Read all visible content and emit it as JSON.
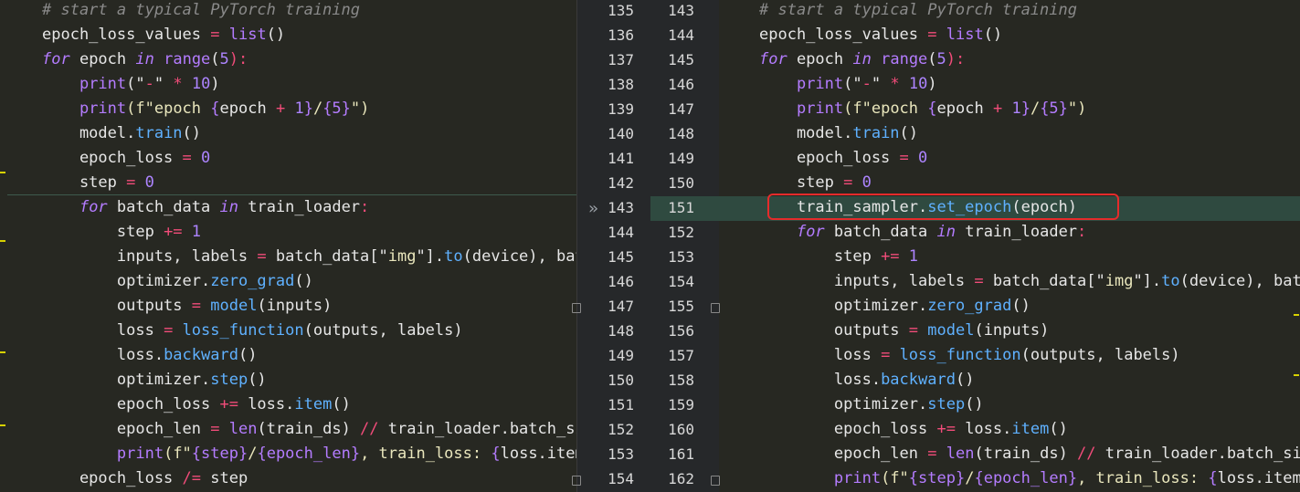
{
  "left_pane": {
    "lines": [
      [
        [
          "# start a typical PyTorch training",
          "comment"
        ]
      ],
      [
        [
          "epoch_loss_values ",
          "plain"
        ],
        [
          "=",
          "op"
        ],
        [
          " ",
          "plain"
        ],
        [
          "list",
          "builtin"
        ],
        [
          "()",
          "plain"
        ]
      ],
      [
        [
          "for",
          "keyword"
        ],
        [
          " epoch ",
          "plain"
        ],
        [
          "in",
          "keyword"
        ],
        [
          " ",
          "plain"
        ],
        [
          "range",
          "builtin"
        ],
        [
          "(",
          "plain"
        ],
        [
          "5",
          "num"
        ],
        [
          "):",
          "op"
        ]
      ],
      [
        [
          "    ",
          "plain"
        ],
        [
          "print",
          "builtin"
        ],
        [
          "(\"",
          "plain"
        ],
        [
          "-",
          "op"
        ],
        [
          "\"",
          "plain"
        ],
        [
          " * ",
          "op"
        ],
        [
          "10",
          "num"
        ],
        [
          ")",
          "plain"
        ]
      ],
      [
        [
          "    ",
          "plain"
        ],
        [
          "print",
          "builtin"
        ],
        [
          "(f\"epoch ",
          "str"
        ],
        [
          "{",
          "fmt"
        ],
        [
          "epoch ",
          "plain"
        ],
        [
          "+",
          "op"
        ],
        [
          " ",
          "plain"
        ],
        [
          "1",
          "num"
        ],
        [
          "}",
          "fmt"
        ],
        [
          "/",
          "str"
        ],
        [
          "{5}",
          "fmt"
        ],
        [
          "\")",
          "str"
        ]
      ],
      [
        [
          "    model.",
          "plain"
        ],
        [
          "train",
          "func"
        ],
        [
          "()",
          "plain"
        ]
      ],
      [
        [
          "    epoch_loss ",
          "plain"
        ],
        [
          "=",
          "op"
        ],
        [
          " ",
          "plain"
        ],
        [
          "0",
          "num"
        ]
      ],
      [
        [
          "    step ",
          "plain"
        ],
        [
          "=",
          "op"
        ],
        [
          " ",
          "plain"
        ],
        [
          "0",
          "num"
        ]
      ],
      [
        [
          "    ",
          "plain"
        ],
        [
          "for",
          "keyword"
        ],
        [
          " batch_data ",
          "plain"
        ],
        [
          "in",
          "keyword"
        ],
        [
          " train_loader",
          "plain"
        ],
        [
          ":",
          "op"
        ]
      ],
      [
        [
          "        step ",
          "plain"
        ],
        [
          "+=",
          "op"
        ],
        [
          " ",
          "plain"
        ],
        [
          "1",
          "num"
        ]
      ],
      [
        [
          "        inputs, labels ",
          "plain"
        ],
        [
          "=",
          "op"
        ],
        [
          " batch_data[\"",
          "plain"
        ],
        [
          "img",
          "str"
        ],
        [
          "\"].",
          "plain"
        ],
        [
          "to",
          "func"
        ],
        [
          "(device), bat",
          "plain"
        ]
      ],
      [
        [
          "        optimizer.",
          "plain"
        ],
        [
          "zero_grad",
          "func"
        ],
        [
          "()",
          "plain"
        ]
      ],
      [
        [
          "        outputs ",
          "plain"
        ],
        [
          "=",
          "op"
        ],
        [
          " ",
          "plain"
        ],
        [
          "model",
          "func"
        ],
        [
          "(inputs)",
          "plain"
        ]
      ],
      [
        [
          "        loss ",
          "plain"
        ],
        [
          "=",
          "op"
        ],
        [
          " ",
          "plain"
        ],
        [
          "loss_function",
          "func"
        ],
        [
          "(outputs, labels)",
          "plain"
        ]
      ],
      [
        [
          "        loss.",
          "plain"
        ],
        [
          "backward",
          "func"
        ],
        [
          "()",
          "plain"
        ]
      ],
      [
        [
          "        optimizer.",
          "plain"
        ],
        [
          "step",
          "func"
        ],
        [
          "()",
          "plain"
        ]
      ],
      [
        [
          "        epoch_loss ",
          "plain"
        ],
        [
          "+=",
          "op"
        ],
        [
          " loss.",
          "plain"
        ],
        [
          "item",
          "func"
        ],
        [
          "()",
          "plain"
        ]
      ],
      [
        [
          "        epoch_len ",
          "plain"
        ],
        [
          "=",
          "op"
        ],
        [
          " ",
          "plain"
        ],
        [
          "len",
          "builtin"
        ],
        [
          "(train_ds) ",
          "plain"
        ],
        [
          "//",
          "op"
        ],
        [
          " train_loader.batch_si",
          "plain"
        ]
      ],
      [
        [
          "        ",
          "plain"
        ],
        [
          "print",
          "builtin"
        ],
        [
          "(f\"",
          "str"
        ],
        [
          "{step}",
          "fmt"
        ],
        [
          "/",
          "str"
        ],
        [
          "{epoch_len}",
          "fmt"
        ],
        [
          ", train_loss: ",
          "str"
        ],
        [
          "{",
          "fmt"
        ],
        [
          "loss.item",
          "plain"
        ]
      ],
      [
        [
          "    epoch_loss ",
          "plain"
        ],
        [
          "/=",
          "op"
        ],
        [
          " step",
          "plain"
        ]
      ]
    ]
  },
  "gutter": {
    "left_numbers": [
      "135",
      "136",
      "137",
      "138",
      "139",
      "140",
      "141",
      "142",
      "143",
      "144",
      "145",
      "146",
      "147",
      "148",
      "149",
      "150",
      "151",
      "152",
      "153",
      "154"
    ],
    "right_numbers": [
      "143",
      "144",
      "145",
      "146",
      "147",
      "148",
      "149",
      "150",
      "151",
      "152",
      "153",
      "154",
      "155",
      "156",
      "157",
      "158",
      "159",
      "160",
      "161",
      "162"
    ],
    "left_arrow_icon": "»",
    "right_arrow_icon": "«"
  },
  "right_pane": {
    "lines": [
      [
        [
          "# start a typical PyTorch training",
          "comment"
        ]
      ],
      [
        [
          "epoch_loss_values ",
          "plain"
        ],
        [
          "=",
          "op"
        ],
        [
          " ",
          "plain"
        ],
        [
          "list",
          "builtin"
        ],
        [
          "()",
          "plain"
        ]
      ],
      [
        [
          "for",
          "keyword"
        ],
        [
          " epoch ",
          "plain"
        ],
        [
          "in",
          "keyword"
        ],
        [
          " ",
          "plain"
        ],
        [
          "range",
          "builtin"
        ],
        [
          "(",
          "plain"
        ],
        [
          "5",
          "num"
        ],
        [
          "):",
          "op"
        ]
      ],
      [
        [
          "    ",
          "plain"
        ],
        [
          "print",
          "builtin"
        ],
        [
          "(\"",
          "plain"
        ],
        [
          "-",
          "op"
        ],
        [
          "\"",
          "plain"
        ],
        [
          " * ",
          "op"
        ],
        [
          "10",
          "num"
        ],
        [
          ")",
          "plain"
        ]
      ],
      [
        [
          "    ",
          "plain"
        ],
        [
          "print",
          "builtin"
        ],
        [
          "(f\"epoch ",
          "str"
        ],
        [
          "{",
          "fmt"
        ],
        [
          "epoch ",
          "plain"
        ],
        [
          "+",
          "op"
        ],
        [
          " ",
          "plain"
        ],
        [
          "1",
          "num"
        ],
        [
          "}",
          "fmt"
        ],
        [
          "/",
          "str"
        ],
        [
          "{5}",
          "fmt"
        ],
        [
          "\")",
          "str"
        ]
      ],
      [
        [
          "    model.",
          "plain"
        ],
        [
          "train",
          "func"
        ],
        [
          "()",
          "plain"
        ]
      ],
      [
        [
          "    epoch_loss ",
          "plain"
        ],
        [
          "=",
          "op"
        ],
        [
          " ",
          "plain"
        ],
        [
          "0",
          "num"
        ]
      ],
      [
        [
          "    step ",
          "plain"
        ],
        [
          "=",
          "op"
        ],
        [
          " ",
          "plain"
        ],
        [
          "0",
          "num"
        ]
      ],
      [
        [
          "    train_sampler.",
          "plain"
        ],
        [
          "set_epoch",
          "func"
        ],
        [
          "(epoch)",
          "plain"
        ]
      ],
      [
        [
          "    ",
          "plain"
        ],
        [
          "for",
          "keyword"
        ],
        [
          " batch_data ",
          "plain"
        ],
        [
          "in",
          "keyword"
        ],
        [
          " train_loader",
          "plain"
        ],
        [
          ":",
          "op"
        ]
      ],
      [
        [
          "        step ",
          "plain"
        ],
        [
          "+=",
          "op"
        ],
        [
          " ",
          "plain"
        ],
        [
          "1",
          "num"
        ]
      ],
      [
        [
          "        inputs, labels ",
          "plain"
        ],
        [
          "=",
          "op"
        ],
        [
          " batch_data[\"",
          "plain"
        ],
        [
          "img",
          "str"
        ],
        [
          "\"].",
          "plain"
        ],
        [
          "to",
          "func"
        ],
        [
          "(device), batch",
          "plain"
        ]
      ],
      [
        [
          "        optimizer.",
          "plain"
        ],
        [
          "zero_grad",
          "func"
        ],
        [
          "()",
          "plain"
        ]
      ],
      [
        [
          "        outputs ",
          "plain"
        ],
        [
          "=",
          "op"
        ],
        [
          " ",
          "plain"
        ],
        [
          "model",
          "func"
        ],
        [
          "(inputs)",
          "plain"
        ]
      ],
      [
        [
          "        loss ",
          "plain"
        ],
        [
          "=",
          "op"
        ],
        [
          " ",
          "plain"
        ],
        [
          "loss_function",
          "func"
        ],
        [
          "(outputs, labels)",
          "plain"
        ]
      ],
      [
        [
          "        loss.",
          "plain"
        ],
        [
          "backward",
          "func"
        ],
        [
          "()",
          "plain"
        ]
      ],
      [
        [
          "        optimizer.",
          "plain"
        ],
        [
          "step",
          "func"
        ],
        [
          "()",
          "plain"
        ]
      ],
      [
        [
          "        epoch_loss ",
          "plain"
        ],
        [
          "+=",
          "op"
        ],
        [
          " loss.",
          "plain"
        ],
        [
          "item",
          "func"
        ],
        [
          "()",
          "plain"
        ]
      ],
      [
        [
          "        epoch_len ",
          "plain"
        ],
        [
          "=",
          "op"
        ],
        [
          " ",
          "plain"
        ],
        [
          "len",
          "builtin"
        ],
        [
          "(train_ds) ",
          "plain"
        ],
        [
          "//",
          "op"
        ],
        [
          " train_loader.batch_size",
          "plain"
        ]
      ],
      [
        [
          "        ",
          "plain"
        ],
        [
          "print",
          "builtin"
        ],
        [
          "(f\"",
          "str"
        ],
        [
          "{step}",
          "fmt"
        ],
        [
          "/",
          "str"
        ],
        [
          "{epoch_len}",
          "fmt"
        ],
        [
          ", train_loss: ",
          "str"
        ],
        [
          "{",
          "fmt"
        ],
        [
          "loss.item(",
          "plain"
        ]
      ]
    ]
  },
  "colors": {
    "inserted_line_bg": "#2f4a40",
    "highlight_box": "#e52b2b"
  }
}
